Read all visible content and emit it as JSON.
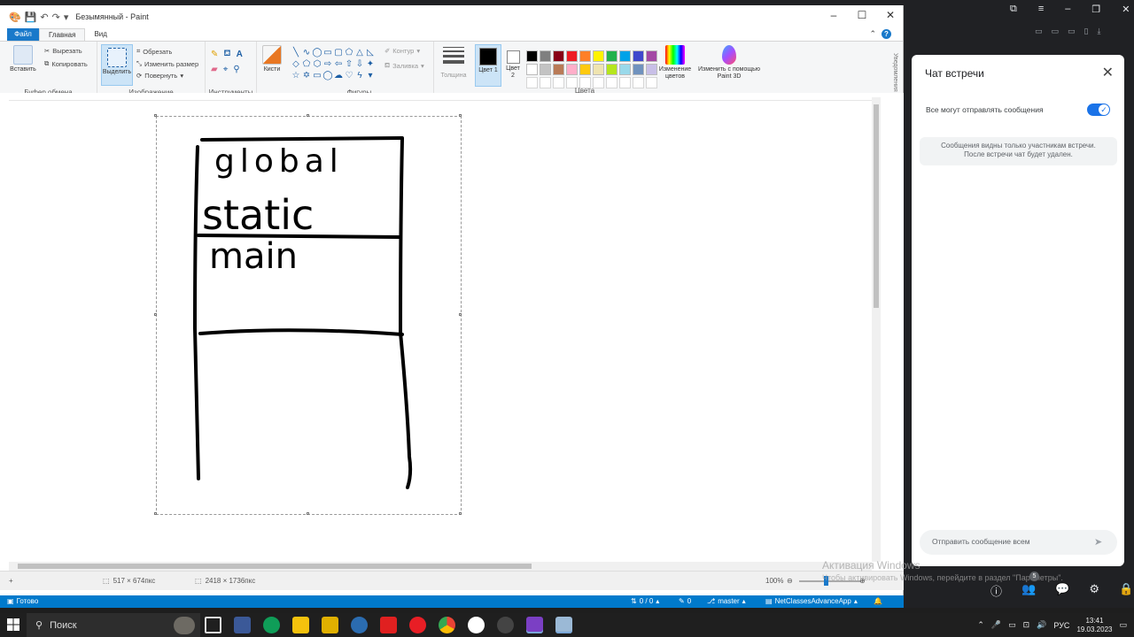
{
  "paint": {
    "title": "Безымянный - Paint",
    "tabs": {
      "file": "Файл",
      "home": "Главная",
      "view": "Вид"
    },
    "clipboard": {
      "paste": "Вставить",
      "cut": "Вырезать",
      "copy": "Копировать",
      "label": "Буфер обмена"
    },
    "image": {
      "select": "Выделить",
      "crop": "Обрезать",
      "resize": "Изменить размер",
      "rotate": "Повернуть",
      "label": "Изображение"
    },
    "tools": {
      "label": "Инструменты"
    },
    "brushes": {
      "label": "Кисти"
    },
    "shapes": {
      "label": "Фигуры",
      "outline": "Контур",
      "fill": "Заливка"
    },
    "size": {
      "label": "Толщина"
    },
    "colors": {
      "color1": "Цвет 1",
      "color2": "Цвет 2",
      "edit": "Изменение цветов",
      "label": "Цвета",
      "paint3d": "Изменить с помощью Paint 3D",
      "palette": [
        "#000000",
        "#7f7f7f",
        "#880015",
        "#ed1c24",
        "#ff7f27",
        "#fff200",
        "#22b14c",
        "#00a2e8",
        "#3f48cc",
        "#a349a4",
        "#ffffff",
        "#c3c3c3",
        "#b97a57",
        "#ffaec9",
        "#ffc90e",
        "#efe4b0",
        "#b5e61d",
        "#99d9ea",
        "#7092be",
        "#c8bfe7",
        "#ffffff",
        "#ffffff",
        "#ffffff",
        "#ffffff",
        "#ffffff",
        "#ffffff",
        "#ffffff",
        "#ffffff",
        "#ffffff",
        "#ffffff"
      ]
    },
    "side_label": "Уведомления",
    "drawing_texts": {
      "line1": "global",
      "line2": "static",
      "line3": "main"
    },
    "status": {
      "selection_size": "517 × 674пкс",
      "image_size": "2418 × 1736пкс",
      "zoom": "100%"
    }
  },
  "vs_status": {
    "ready": "Готово",
    "changes": "0 / 0",
    "pencil": "0",
    "branch": "master",
    "repo": "NetClassesAdvanceApp"
  },
  "meet": {
    "chat_title": "Чат встречи",
    "toggle_label": "Все могут отправлять сообщения",
    "notice_line1": "Сообщения видны только участникам встречи.",
    "notice_line2": "После встречи чат будет удален.",
    "input_placeholder": "Отправить сообщение всем",
    "badge_count": "5"
  },
  "watermark": {
    "line1": "Активация Windows",
    "line2": "Чтобы активировать Windows, перейдите в раздел \"Параметры\"."
  },
  "taskbar": {
    "search_text": "Поиск",
    "lang": "РУС",
    "time": "13:41",
    "date": "19.03.2023"
  }
}
